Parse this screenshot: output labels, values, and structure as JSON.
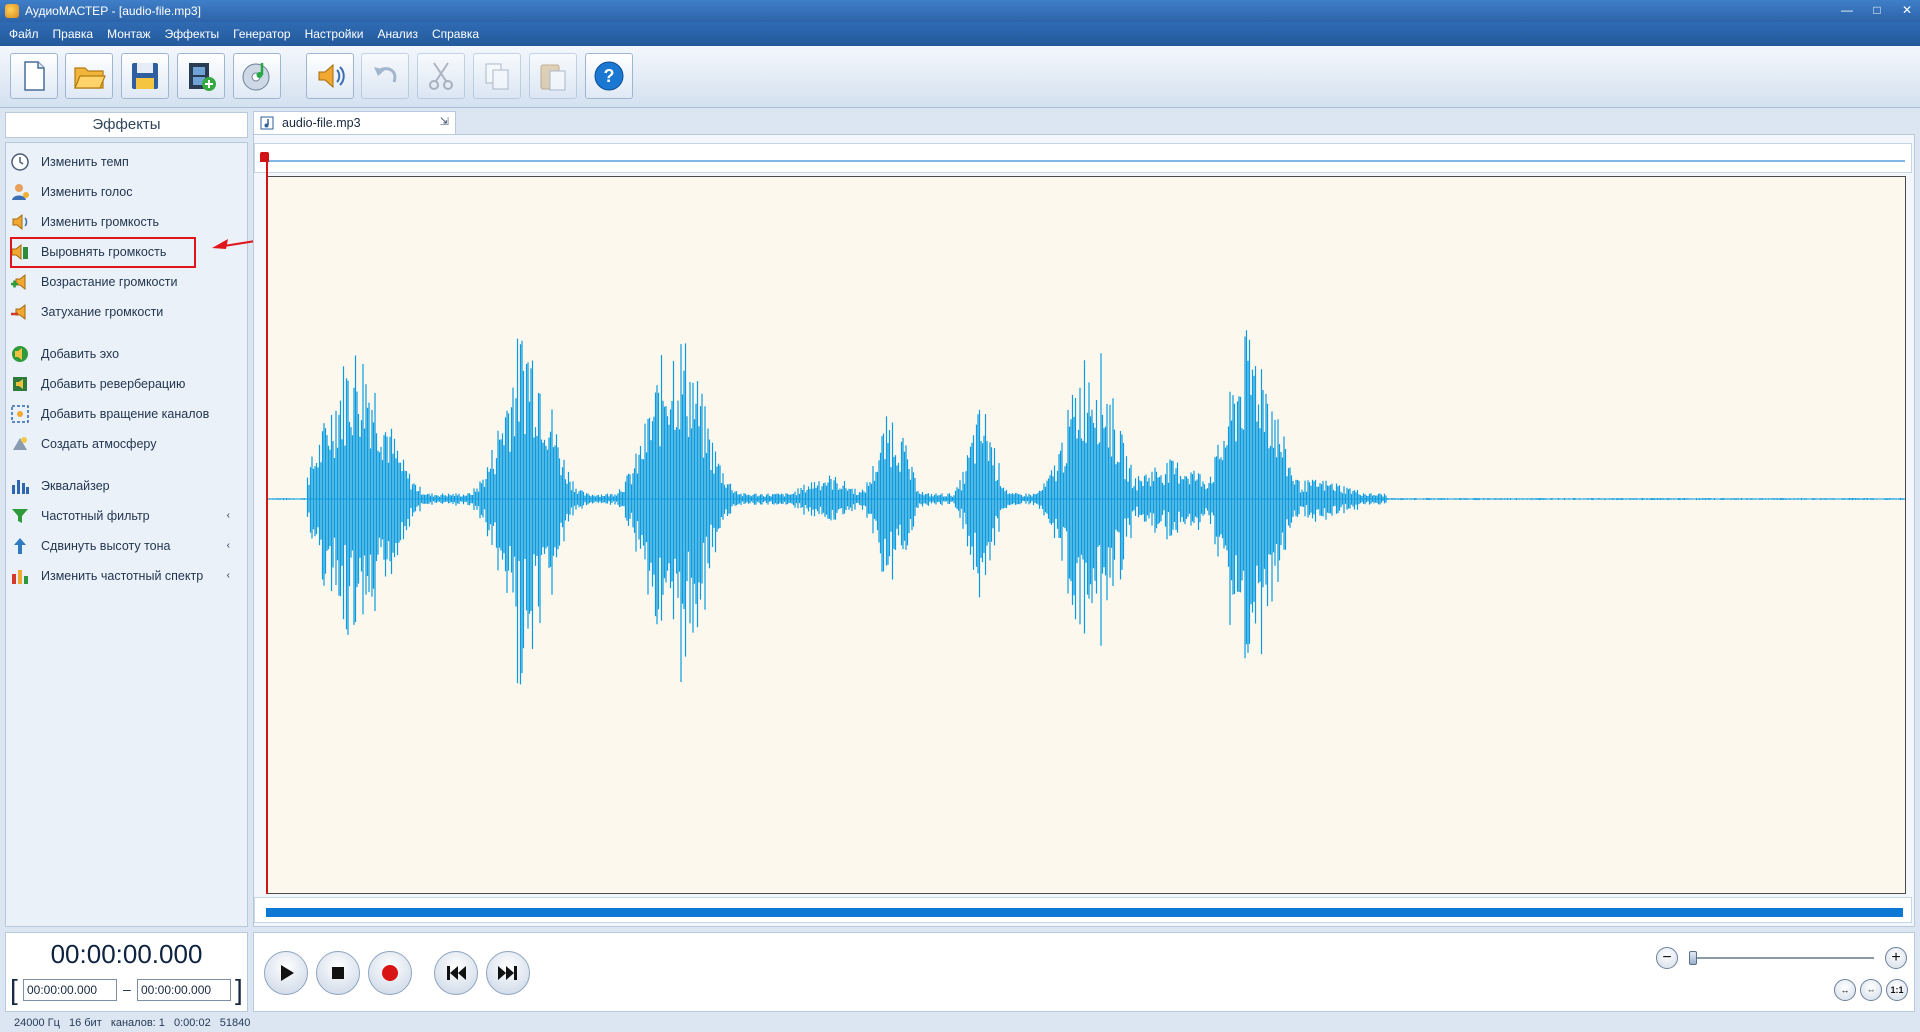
{
  "window": {
    "title": "АудиоМАСТЕР - [audio-file.mp3]",
    "minimize": "—",
    "maximize": "□",
    "close": "✕"
  },
  "menu": [
    "Файл",
    "Правка",
    "Монтаж",
    "Эффекты",
    "Генератор",
    "Настройки",
    "Анализ",
    "Справка"
  ],
  "toolbar": {
    "buttons": [
      {
        "icon": "new-file-icon",
        "enabled": true
      },
      {
        "icon": "open-folder-icon",
        "enabled": true
      },
      {
        "icon": "save-disk-icon",
        "enabled": true
      },
      {
        "icon": "add-video-icon",
        "enabled": true
      },
      {
        "icon": "cd-music-icon",
        "enabled": true
      },
      {
        "icon": "volume-speaker-icon",
        "enabled": true
      },
      {
        "icon": "undo-icon",
        "enabled": false
      },
      {
        "icon": "cut-scissors-icon",
        "enabled": false
      },
      {
        "icon": "copy-icon",
        "enabled": false
      },
      {
        "icon": "paste-icon",
        "enabled": false
      },
      {
        "icon": "help-icon",
        "enabled": true
      }
    ]
  },
  "effects": {
    "header": "Эффекты",
    "items": [
      {
        "label": "Изменить темп",
        "icon": "clock-icon",
        "submenu": false
      },
      {
        "label": "Изменить голос",
        "icon": "user-voice-icon",
        "submenu": false
      },
      {
        "label": "Изменить громкость",
        "icon": "volume-icon",
        "submenu": false
      },
      {
        "label": "Выровнять громкость",
        "icon": "normalize-volume-icon",
        "submenu": false,
        "highlighted": true
      },
      {
        "label": "Возрастание громкости",
        "icon": "fade-in-icon",
        "submenu": false
      },
      {
        "label": "Затухание громкости",
        "icon": "fade-out-icon",
        "submenu": false
      },
      {
        "label": "Добавить эхо",
        "icon": "echo-icon",
        "submenu": false
      },
      {
        "label": "Добавить реверберацию",
        "icon": "reverb-icon",
        "submenu": false
      },
      {
        "label": "Добавить вращение каналов",
        "icon": "channel-rotate-icon",
        "submenu": false
      },
      {
        "label": "Создать атмосферу",
        "icon": "atmosphere-icon",
        "submenu": false
      },
      {
        "label": "Эквалайзер",
        "icon": "equalizer-icon",
        "submenu": false
      },
      {
        "label": "Частотный фильтр",
        "icon": "filter-funnel-icon",
        "submenu": true
      },
      {
        "label": "Сдвинуть высоту тона",
        "icon": "pitch-shift-icon",
        "submenu": true
      },
      {
        "label": "Изменить частотный спектр",
        "icon": "spectrum-icon",
        "submenu": true
      }
    ],
    "submenu_glyph": "‹"
  },
  "file_tab": {
    "label": "audio-file.mp3",
    "pin": "⇲"
  },
  "colors": {
    "waveform": "#0a9be0",
    "waveform_bg": "#fdf8ed",
    "playhead": "#d21414",
    "highlight": "#e0161c"
  },
  "time": {
    "current": "00:00:00.000",
    "selection_start": "00:00:00.000",
    "selection_end": "00:00:00.000",
    "range_dash": "–",
    "bracket_left": "[",
    "bracket_right": "]"
  },
  "transport": {
    "buttons": [
      "play-icon",
      "stop-icon",
      "record-icon",
      "rewind-icon",
      "fast-forward-icon"
    ]
  },
  "zoom": {
    "out_label": "−",
    "in_label": "+",
    "level": 0.0,
    "fit_buttons": [
      "↔",
      "⇔",
      "1:1"
    ]
  },
  "status": {
    "sample_rate": "24000 Гц",
    "bits": "16 бит",
    "channels": "каналов: 1",
    "duration": "0:00:02",
    "samples": "51840"
  }
}
